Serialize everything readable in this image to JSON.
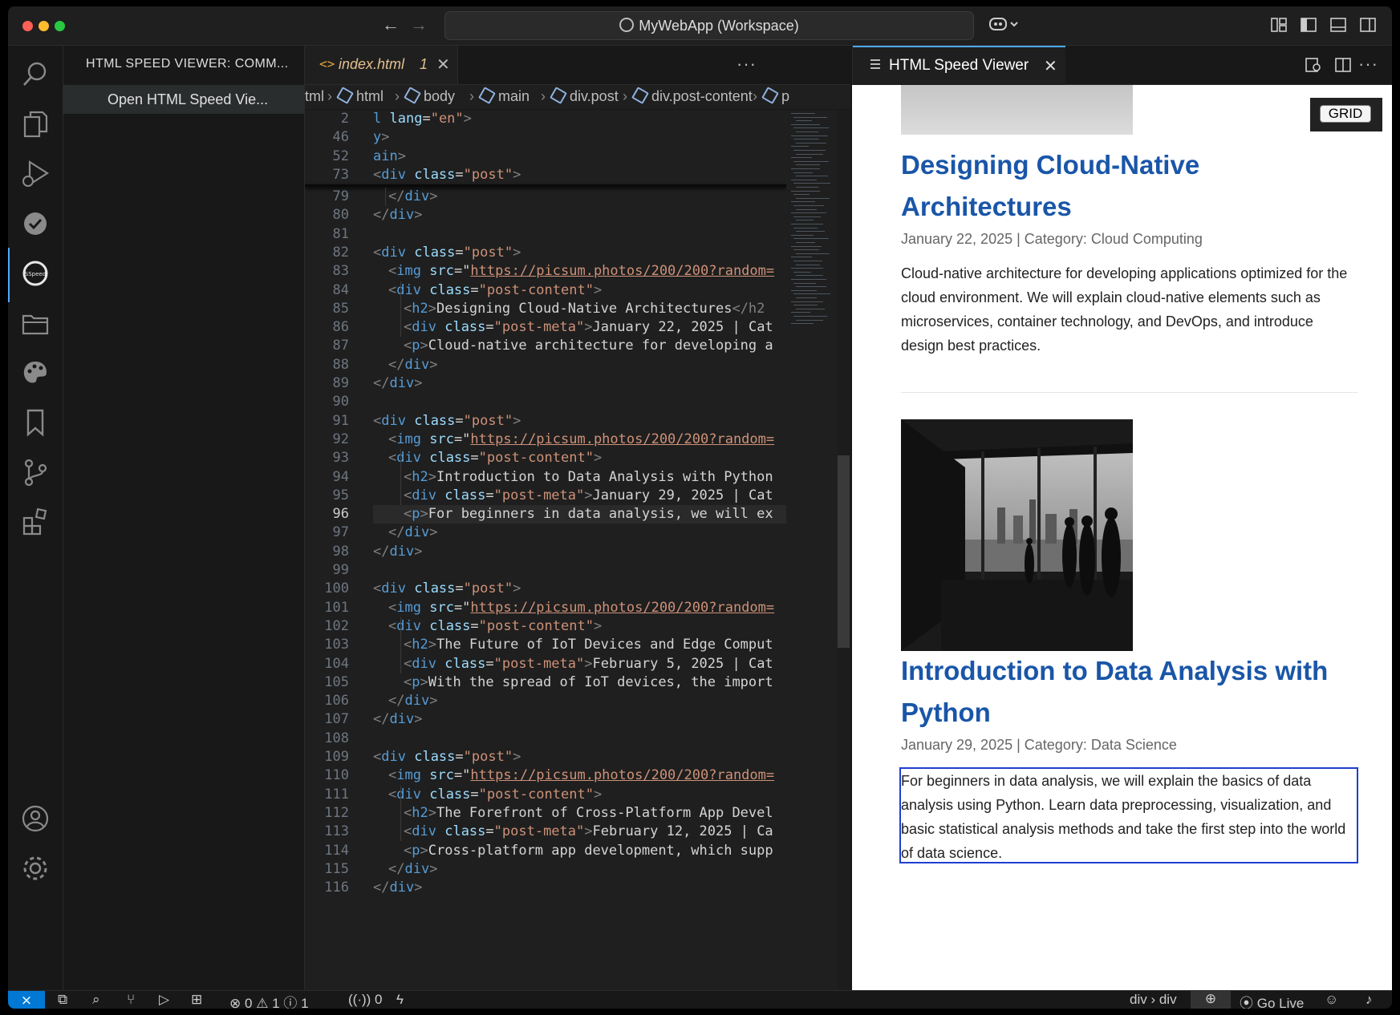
{
  "title_bar": {
    "command_center": "MyWebApp (Workspace)"
  },
  "sidebar": {
    "title": "HTML SPEED VIEWER: COMM...",
    "items": [
      {
        "label": "Open HTML Speed Vie..."
      }
    ]
  },
  "activity_bar": {
    "icons": [
      "search-icon",
      "explorer-icon",
      "run-debug-icon",
      "check-icon",
      "speed-viewer-icon",
      "folder-icon",
      "palette-icon",
      "bookmark-icon",
      "source-control-icon",
      "extensions-icon",
      "account-icon",
      "settings-icon"
    ]
  },
  "editor": {
    "tab": {
      "name": "index.html",
      "problems": "1"
    },
    "breadcrumb": [
      "tml",
      "html",
      "body",
      "main",
      "div.post",
      "div.post-content",
      "p"
    ],
    "sticky_lines": [
      {
        "n": "2",
        "text": "l lang=\"en\">"
      },
      {
        "n": "46",
        "text": "y>"
      },
      {
        "n": "52",
        "text": "ain>"
      },
      {
        "n": "73",
        "text": "<div class=\"post\">"
      }
    ],
    "lines": [
      {
        "n": "79",
        "indent": 1,
        "kind": "close",
        "tag": "div"
      },
      {
        "n": "80",
        "indent": 0,
        "kind": "close",
        "tag": "div"
      },
      {
        "n": "81",
        "indent": 0,
        "kind": "blank"
      },
      {
        "n": "82",
        "indent": 0,
        "kind": "open",
        "tag": "div",
        "attr": "class",
        "val": "post"
      },
      {
        "n": "83",
        "indent": 1,
        "kind": "img",
        "tag": "img",
        "attr": "src",
        "val": "https://picsum.photos/200/200?random="
      },
      {
        "n": "84",
        "indent": 1,
        "kind": "open",
        "tag": "div",
        "attr": "class",
        "val": "post-content"
      },
      {
        "n": "85",
        "indent": 2,
        "kind": "h2",
        "tag": "h2",
        "text": "Designing Cloud-Native Architectures",
        "close": "</h2"
      },
      {
        "n": "86",
        "indent": 2,
        "kind": "meta",
        "tag": "div",
        "attr": "class",
        "val": "post-meta",
        "text": "January 22, 2025 | Cat"
      },
      {
        "n": "87",
        "indent": 2,
        "kind": "p",
        "tag": "p",
        "text": "Cloud-native architecture for developing a"
      },
      {
        "n": "88",
        "indent": 1,
        "kind": "close",
        "tag": "div"
      },
      {
        "n": "89",
        "indent": 0,
        "kind": "close",
        "tag": "div"
      },
      {
        "n": "90",
        "indent": 0,
        "kind": "blank"
      },
      {
        "n": "91",
        "indent": 0,
        "kind": "open",
        "tag": "div",
        "attr": "class",
        "val": "post"
      },
      {
        "n": "92",
        "indent": 1,
        "kind": "img",
        "tag": "img",
        "attr": "src",
        "val": "https://picsum.photos/200/200?random="
      },
      {
        "n": "93",
        "indent": 1,
        "kind": "open",
        "tag": "div",
        "attr": "class",
        "val": "post-content"
      },
      {
        "n": "94",
        "indent": 2,
        "kind": "h2",
        "tag": "h2",
        "text": "Introduction to Data Analysis with Python",
        "close": ""
      },
      {
        "n": "95",
        "indent": 2,
        "kind": "meta",
        "tag": "div",
        "attr": "class",
        "val": "post-meta",
        "text": "January 29, 2025 | Cat"
      },
      {
        "n": "96",
        "indent": 2,
        "kind": "p",
        "tag": "p",
        "text": "For beginners in data analysis, we will ex"
      },
      {
        "n": "97",
        "indent": 1,
        "kind": "close",
        "tag": "div"
      },
      {
        "n": "98",
        "indent": 0,
        "kind": "close",
        "tag": "div"
      },
      {
        "n": "99",
        "indent": 0,
        "kind": "blank"
      },
      {
        "n": "100",
        "indent": 0,
        "kind": "open",
        "tag": "div",
        "attr": "class",
        "val": "post"
      },
      {
        "n": "101",
        "indent": 1,
        "kind": "img",
        "tag": "img",
        "attr": "src",
        "val": "https://picsum.photos/200/200?random="
      },
      {
        "n": "102",
        "indent": 1,
        "kind": "open",
        "tag": "div",
        "attr": "class",
        "val": "post-content"
      },
      {
        "n": "103",
        "indent": 2,
        "kind": "h2",
        "tag": "h2",
        "text": "The Future of IoT Devices and Edge Comput",
        "close": ""
      },
      {
        "n": "104",
        "indent": 2,
        "kind": "meta",
        "tag": "div",
        "attr": "class",
        "val": "post-meta",
        "text": "February 5, 2025 | Cat"
      },
      {
        "n": "105",
        "indent": 2,
        "kind": "p",
        "tag": "p",
        "text": "With the spread of IoT devices, the import"
      },
      {
        "n": "106",
        "indent": 1,
        "kind": "close",
        "tag": "div"
      },
      {
        "n": "107",
        "indent": 0,
        "kind": "close",
        "tag": "div"
      },
      {
        "n": "108",
        "indent": 0,
        "kind": "blank"
      },
      {
        "n": "109",
        "indent": 0,
        "kind": "open",
        "tag": "div",
        "attr": "class",
        "val": "post"
      },
      {
        "n": "110",
        "indent": 1,
        "kind": "img",
        "tag": "img",
        "attr": "src",
        "val": "https://picsum.photos/200/200?random="
      },
      {
        "n": "111",
        "indent": 1,
        "kind": "open",
        "tag": "div",
        "attr": "class",
        "val": "post-content"
      },
      {
        "n": "112",
        "indent": 2,
        "kind": "h2",
        "tag": "h2",
        "text": "The Forefront of Cross-Platform App Devel",
        "close": ""
      },
      {
        "n": "113",
        "indent": 2,
        "kind": "meta",
        "tag": "div",
        "attr": "class",
        "val": "post-meta",
        "text": "February 12, 2025 | Ca"
      },
      {
        "n": "114",
        "indent": 2,
        "kind": "p",
        "tag": "p",
        "text": "Cross-platform app development, which supp"
      },
      {
        "n": "115",
        "indent": 1,
        "kind": "close",
        "tag": "div"
      },
      {
        "n": "116",
        "indent": 0,
        "kind": "close",
        "tag": "div"
      }
    ],
    "current_line": "96"
  },
  "viewer": {
    "tab": "HTML Speed Viewer",
    "grid_button": "GRID",
    "posts": [
      {
        "title": "Designing Cloud-Native Architectures",
        "meta": "January 22, 2025 | Category: Cloud Computing",
        "body": "Cloud-native architecture for developing applications optimized for the cloud environment. We will explain cloud-native elements such as microservices, container technology, and DevOps, and introduce design best practices."
      },
      {
        "title": "Introduction to Data Analysis with Python",
        "meta": "January 29, 2025 | Category: Data Science",
        "body": "For beginners in data analysis, we will explain the basics of data analysis using Python. Learn data preprocessing, visualization, and basic statistical analysis methods and take the first step into the world of data science."
      }
    ]
  },
  "status_bar": {
    "errors": "0",
    "warnings": "1",
    "info": "1",
    "ports": "0",
    "element_path": "div › div",
    "go_live": "Go Live"
  },
  "colors": {
    "accent": "#0078d4",
    "link_title": "#1a56a8",
    "selection_outline": "#1f3fd1"
  }
}
